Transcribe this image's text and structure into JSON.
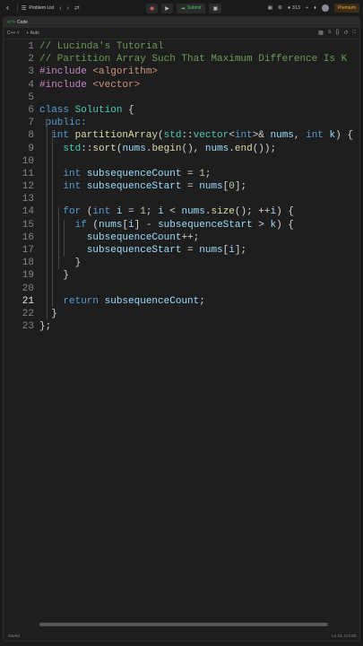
{
  "topbar": {
    "problem_list_label": "Problem List",
    "submit_label": "Submit",
    "streak_count": "313",
    "premium_label": "Premium"
  },
  "panel": {
    "code_tag": "</>",
    "title": "Code",
    "language": "C++",
    "autosave_label": "Auto"
  },
  "code_lines": [
    [
      {
        "t": "// Lucinda's Tutorial",
        "c": "c-com"
      }
    ],
    [
      {
        "t": "// Partition Array Such That Maximum Difference Is K",
        "c": "c-com"
      }
    ],
    [
      {
        "t": "#include ",
        "c": "c-pp"
      },
      {
        "t": "<algorithm>",
        "c": "c-inc"
      }
    ],
    [
      {
        "t": "#include ",
        "c": "c-pp"
      },
      {
        "t": "<vector>",
        "c": "c-inc"
      }
    ],
    [],
    [
      {
        "t": "class ",
        "c": "c-kw"
      },
      {
        "t": "Solution",
        "c": "c-ty"
      },
      {
        "t": " {",
        "c": ""
      }
    ],
    [
      {
        "t": " public:",
        "c": "c-kw"
      }
    ],
    [
      {
        "t": "  ",
        "c": ""
      },
      {
        "t": "int ",
        "c": "c-kw"
      },
      {
        "t": "partitionArray",
        "c": "c-fn"
      },
      {
        "t": "(",
        "c": ""
      },
      {
        "t": "std",
        "c": "c-ty"
      },
      {
        "t": "::",
        "c": ""
      },
      {
        "t": "vector",
        "c": "c-ty"
      },
      {
        "t": "<",
        "c": ""
      },
      {
        "t": "int",
        "c": "c-kw"
      },
      {
        "t": ">& ",
        "c": ""
      },
      {
        "t": "nums",
        "c": "c-var"
      },
      {
        "t": ", ",
        "c": ""
      },
      {
        "t": "int ",
        "c": "c-kw"
      },
      {
        "t": "k",
        "c": "c-var"
      },
      {
        "t": ") {",
        "c": ""
      }
    ],
    [
      {
        "t": "    ",
        "c": ""
      },
      {
        "t": "std",
        "c": "c-ty"
      },
      {
        "t": "::",
        "c": ""
      },
      {
        "t": "sort",
        "c": "c-fn"
      },
      {
        "t": "(",
        "c": ""
      },
      {
        "t": "nums",
        "c": "c-var"
      },
      {
        "t": ".",
        "c": ""
      },
      {
        "t": "begin",
        "c": "c-fn"
      },
      {
        "t": "(), ",
        "c": ""
      },
      {
        "t": "nums",
        "c": "c-var"
      },
      {
        "t": ".",
        "c": ""
      },
      {
        "t": "end",
        "c": "c-fn"
      },
      {
        "t": "());",
        "c": ""
      }
    ],
    [],
    [
      {
        "t": "    ",
        "c": ""
      },
      {
        "t": "int ",
        "c": "c-kw"
      },
      {
        "t": "subsequenceCount",
        "c": "c-var"
      },
      {
        "t": " = ",
        "c": ""
      },
      {
        "t": "1",
        "c": "c-num"
      },
      {
        "t": ";",
        "c": ""
      }
    ],
    [
      {
        "t": "    ",
        "c": ""
      },
      {
        "t": "int ",
        "c": "c-kw"
      },
      {
        "t": "subsequenceStart",
        "c": "c-var"
      },
      {
        "t": " = ",
        "c": ""
      },
      {
        "t": "nums",
        "c": "c-var"
      },
      {
        "t": "[",
        "c": ""
      },
      {
        "t": "0",
        "c": "c-num"
      },
      {
        "t": "];",
        "c": ""
      }
    ],
    [],
    [
      {
        "t": "    ",
        "c": ""
      },
      {
        "t": "for ",
        "c": "c-kw"
      },
      {
        "t": "(",
        "c": ""
      },
      {
        "t": "int ",
        "c": "c-kw"
      },
      {
        "t": "i",
        "c": "c-var"
      },
      {
        "t": " = ",
        "c": ""
      },
      {
        "t": "1",
        "c": "c-num"
      },
      {
        "t": "; ",
        "c": ""
      },
      {
        "t": "i",
        "c": "c-var"
      },
      {
        "t": " < ",
        "c": ""
      },
      {
        "t": "nums",
        "c": "c-var"
      },
      {
        "t": ".",
        "c": ""
      },
      {
        "t": "size",
        "c": "c-fn"
      },
      {
        "t": "(); ++",
        "c": ""
      },
      {
        "t": "i",
        "c": "c-var"
      },
      {
        "t": ") {",
        "c": ""
      }
    ],
    [
      {
        "t": "      ",
        "c": ""
      },
      {
        "t": "if ",
        "c": "c-kw"
      },
      {
        "t": "(",
        "c": ""
      },
      {
        "t": "nums",
        "c": "c-var"
      },
      {
        "t": "[",
        "c": ""
      },
      {
        "t": "i",
        "c": "c-var"
      },
      {
        "t": "] - ",
        "c": ""
      },
      {
        "t": "subsequenceStart",
        "c": "c-var"
      },
      {
        "t": " > ",
        "c": ""
      },
      {
        "t": "k",
        "c": "c-var"
      },
      {
        "t": ") {",
        "c": ""
      }
    ],
    [
      {
        "t": "        ",
        "c": ""
      },
      {
        "t": "subsequenceCount",
        "c": "c-var"
      },
      {
        "t": "++;",
        "c": ""
      }
    ],
    [
      {
        "t": "        ",
        "c": ""
      },
      {
        "t": "subsequenceStart",
        "c": "c-var"
      },
      {
        "t": " = ",
        "c": ""
      },
      {
        "t": "nums",
        "c": "c-var"
      },
      {
        "t": "[",
        "c": ""
      },
      {
        "t": "i",
        "c": "c-var"
      },
      {
        "t": "];",
        "c": ""
      }
    ],
    [
      {
        "t": "      }",
        "c": ""
      }
    ],
    [
      {
        "t": "    }",
        "c": ""
      }
    ],
    [],
    [
      {
        "t": "    ",
        "c": ""
      },
      {
        "t": "return ",
        "c": "c-kw"
      },
      {
        "t": "subsequenceCount",
        "c": "c-var"
      },
      {
        "t": ";",
        "c": ""
      }
    ],
    [
      {
        "t": "  }",
        "c": ""
      }
    ],
    [
      {
        "t": "};",
        "c": ""
      }
    ]
  ],
  "active_line": 21,
  "status": {
    "saved_label": "Saved",
    "cursor_position": "Ln 21, Col 28"
  }
}
